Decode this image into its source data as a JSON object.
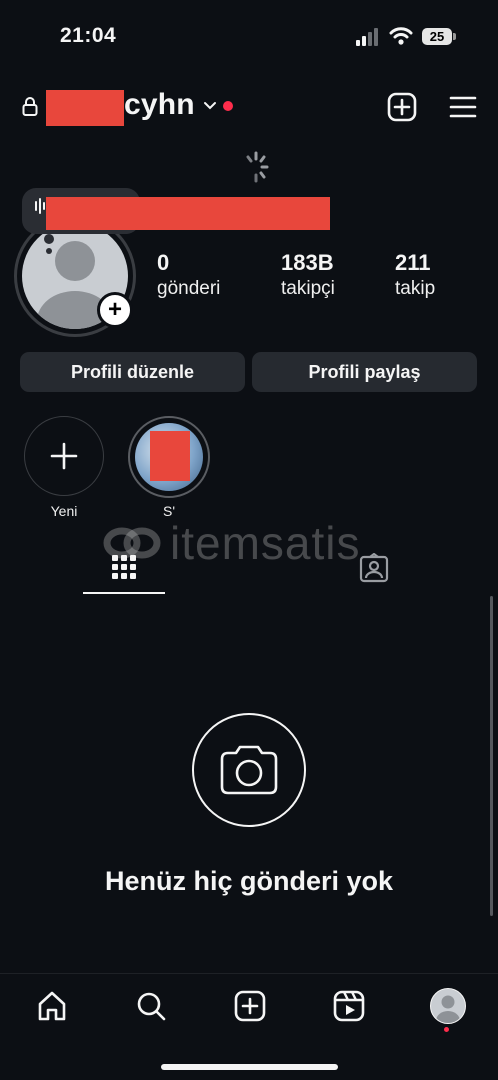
{
  "status_bar": {
    "time": "21:04",
    "battery": "25"
  },
  "header": {
    "username": "cyhn"
  },
  "stats": [
    {
      "value": "0",
      "label": "gönderi"
    },
    {
      "value": "183B",
      "label": "takipçi"
    },
    {
      "value": "211",
      "label": "takip"
    }
  ],
  "buttons": {
    "edit_profile": "Profili düzenle",
    "share_profile": "Profili paylaş"
  },
  "highlights": [
    {
      "label": "Yeni"
    },
    {
      "label": "S'"
    }
  ],
  "watermark": "itemsatis",
  "empty_state": {
    "title": "Henüz hiç gönderi yok"
  },
  "colors": {
    "background": "#0c0f14",
    "button": "#262a30",
    "redaction": "#e8473c",
    "notification": "#ff2d4c"
  }
}
